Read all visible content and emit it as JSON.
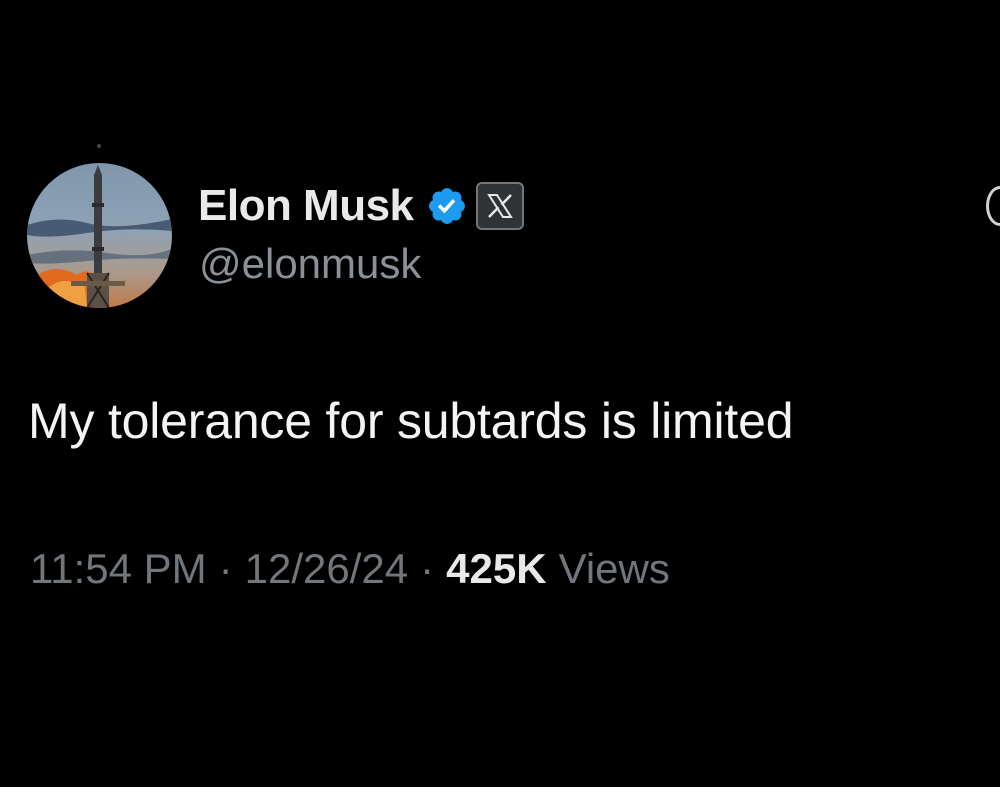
{
  "tweet": {
    "author": {
      "display_name": "Elon Musk",
      "handle": "@elonmusk",
      "avatar_icon": "starship-launch-avatar",
      "verified_icon": "verified-check-icon",
      "verified_color": "#1d9bf0",
      "affiliate_icon": "x-logo-icon"
    },
    "text": "My tolerance for subtards is limited",
    "time": "11:54 PM",
    "separator": "·",
    "date": "12/26/24",
    "views_count": "425K",
    "views_label": "Views"
  },
  "colors": {
    "background": "#000000",
    "primary_text": "#e7e9ea",
    "secondary_text": "#71767b"
  }
}
